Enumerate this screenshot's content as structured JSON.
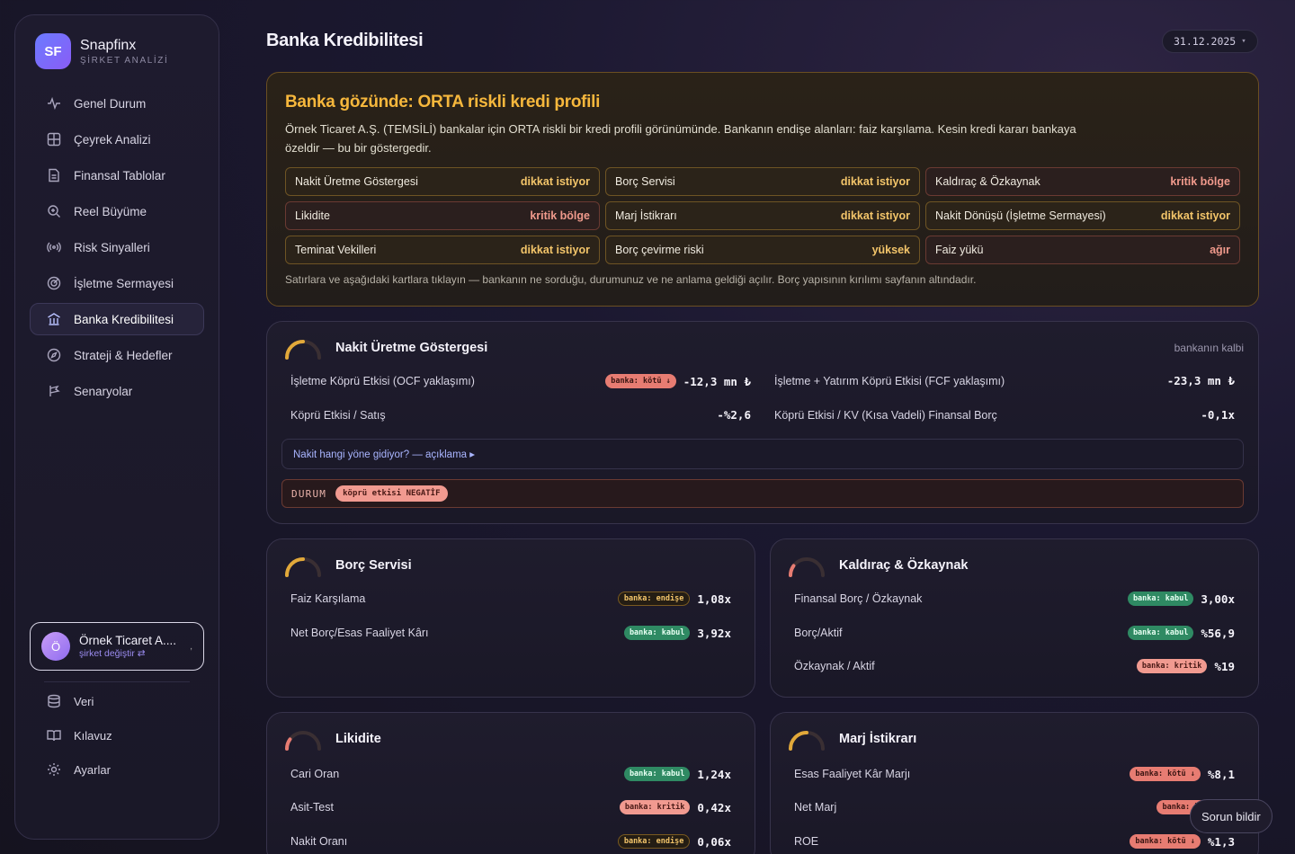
{
  "brand": {
    "logo": "SF",
    "name": "Snapfinx",
    "subtitle": "ŞİRKET ANALİZİ"
  },
  "nav": [
    {
      "label": "Genel Durum",
      "icon": "pulse-icon"
    },
    {
      "label": "Çeyrek Analizi",
      "icon": "grid-icon"
    },
    {
      "label": "Finansal Tablolar",
      "icon": "document-icon"
    },
    {
      "label": "Reel Büyüme",
      "icon": "zoom-icon"
    },
    {
      "label": "Risk Sinyalleri",
      "icon": "signal-icon"
    },
    {
      "label": "İşletme Sermayesi",
      "icon": "target-icon"
    },
    {
      "label": "Banka Kredibilitesi",
      "icon": "bank-icon",
      "active": true
    },
    {
      "label": "Strateji & Hedefler",
      "icon": "compass-icon"
    },
    {
      "label": "Senaryolar",
      "icon": "branch-icon"
    }
  ],
  "company": {
    "avatar": "Ö",
    "name": "Örnek Ticaret A....",
    "sub": "şirket değiştir ⇄",
    "more": ","
  },
  "bottom_nav": [
    {
      "label": "Veri",
      "icon": "database-icon"
    },
    {
      "label": "Kılavuz",
      "icon": "book-icon"
    },
    {
      "label": "Ayarlar",
      "icon": "gear-icon"
    }
  ],
  "header": {
    "title": "Banka Kredibilitesi",
    "date": "31.12.2025",
    "date_caret": "▾"
  },
  "summary": {
    "title": "Banka gözünde: ORTA riskli kredi profili",
    "description": "Örnek Ticaret A.Ş. (TEMSİLİ) bankalar için ORTA riskli bir kredi profili görünümünde. Bankanın endişe alanları: faiz karşılama. Kesin kredi kararı bankaya özeldir — bu bir göstergedir.",
    "tiles": [
      {
        "label": "Nakit Üretme Göstergesi",
        "status": "dikkat istiyor",
        "level": "warn"
      },
      {
        "label": "Borç Servisi",
        "status": "dikkat istiyor",
        "level": "warn"
      },
      {
        "label": "Kaldıraç & Özkaynak",
        "status": "kritik bölge",
        "level": "crit"
      },
      {
        "label": "Likidite",
        "status": "kritik bölge",
        "level": "crit"
      },
      {
        "label": "Marj İstikrarı",
        "status": "dikkat istiyor",
        "level": "warn"
      },
      {
        "label": "Nakit Dönüşü (İşletme Sermayesi)",
        "status": "dikkat istiyor",
        "level": "warn"
      },
      {
        "label": "Teminat Vekilleri",
        "status": "dikkat istiyor",
        "level": "warn"
      },
      {
        "label": "Borç çevirme riski",
        "status": "yüksek",
        "level": "warn"
      },
      {
        "label": "Faiz yükü",
        "status": "ağır",
        "level": "crit"
      }
    ],
    "hint": "Satırlara ve aşağıdaki kartlara tıklayın — bankanın ne sorduğu, durumunuz ve ne anlama geldiği açılır. Borç yapısının kırılımı sayfanın altındadır."
  },
  "cash_card": {
    "title": "Nakit Üretme Göstergesi",
    "gauge_color": "#e2a93a",
    "gauge_fill": 0.5,
    "perspective": "bankanın kalbi",
    "metrics": [
      {
        "label": "İşletme Köprü Etkisi (OCF yaklaşımı)",
        "badge": "banka: kötü ↓",
        "badge_level": "bad",
        "value": "-12,3 mn ₺"
      },
      {
        "label": "İşletme + Yatırım Köprü Etkisi (FCF yaklaşımı)",
        "badge": "",
        "value": "-23,3 mn ₺"
      },
      {
        "label": "Köprü Etkisi / Satış",
        "badge": "",
        "value": "-%2,6"
      },
      {
        "label": "Köprü Etkisi / KV (Kısa Vadeli) Finansal Borç",
        "badge": "",
        "value": "-0,1x"
      }
    ],
    "explain": "Nakit hangi yöne gidiyor? — açıklama ▸",
    "status_label": "DURUM",
    "status_badge": "köprü etkisi NEGATİF"
  },
  "debt_card": {
    "title": "Borç Servisi",
    "gauge_color": "#e2a93a",
    "gauge_fill": 0.5,
    "metrics": [
      {
        "label": "Faiz Karşılama",
        "badge": "banka: endişe",
        "badge_level": "warn",
        "value": "1,08x"
      },
      {
        "label": "Net Borç/Esas Faaliyet Kârı",
        "badge": "banka: kabul",
        "badge_level": "ok",
        "value": "3,92x"
      }
    ]
  },
  "leverage_card": {
    "title": "Kaldıraç & Özkaynak",
    "gauge_color": "#e77c72",
    "gauge_fill": 0.2,
    "metrics": [
      {
        "label": "Finansal Borç / Özkaynak",
        "badge": "banka: kabul",
        "badge_level": "ok",
        "value": "3,00x"
      },
      {
        "label": "Borç/Aktif",
        "badge": "banka: kabul",
        "badge_level": "ok",
        "value": "%56,9"
      },
      {
        "label": "Özkaynak / Aktif",
        "badge": "banka: kritik",
        "badge_level": "crit",
        "value": "%19"
      }
    ]
  },
  "liquidity_card": {
    "title": "Likidite",
    "gauge_color": "#e77c72",
    "gauge_fill": 0.2,
    "metrics": [
      {
        "label": "Cari Oran",
        "badge": "banka: kabul",
        "badge_level": "ok",
        "value": "1,24x"
      },
      {
        "label": "Asit-Test",
        "badge": "banka: kritik",
        "badge_level": "crit",
        "value": "0,42x"
      },
      {
        "label": "Nakit Oranı",
        "badge": "banka: endişe",
        "badge_level": "warn",
        "value": "0,06x"
      }
    ]
  },
  "margin_card": {
    "title": "Marj İstikrarı",
    "gauge_color": "#e2a93a",
    "gauge_fill": 0.5,
    "metrics": [
      {
        "label": "Esas Faaliyet Kâr Marjı",
        "badge": "banka: kötü ↓",
        "badge_level": "bad",
        "value": "%8,1"
      },
      {
        "label": "Net Marj",
        "badge": "banka: kötü ↓",
        "badge_level": "bad",
        "value": ""
      },
      {
        "label": "ROE",
        "badge": "banka: kötü ↓",
        "badge_level": "bad",
        "value": "%1,3"
      }
    ]
  },
  "report_button": "Sorun bildir"
}
